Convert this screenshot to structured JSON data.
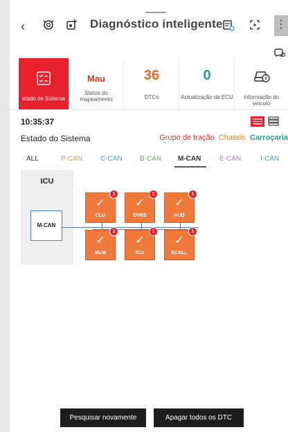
{
  "header": {
    "title": "Diagnóstico inteligente",
    "back_icon": "back-arrow-icon",
    "more_label": "⋮"
  },
  "cards": [
    {
      "main": "",
      "sub": "stado de Sistema",
      "active": true,
      "icon": "checklist-icon"
    },
    {
      "main": "Mau",
      "sub": "Status do mapeamento"
    },
    {
      "main": "36",
      "sub": "DTCs",
      "color": "#e06a2a"
    },
    {
      "main": "0",
      "sub": "Actualização da ECU",
      "color": "#2a9a8e"
    },
    {
      "main": "",
      "sub": "Informação do veículo",
      "icon": "car-info-icon"
    }
  ],
  "status": {
    "time": "10:35:37",
    "title": "Estado do Sistema",
    "links": {
      "tracao": "Grupo de tração",
      "chassis": "Chassis",
      "carrocaria": "Carroçaria"
    }
  },
  "tabs": [
    {
      "label": "ALL",
      "color": "#333333"
    },
    {
      "label": "P-CAN",
      "color": "#e0a24a"
    },
    {
      "label": "C-CAN",
      "color": "#4aa3c9"
    },
    {
      "label": "B-CAN",
      "color": "#6ab04c"
    },
    {
      "label": "M-CAN",
      "color": "#333333",
      "active": true
    },
    {
      "label": "E-CAN",
      "color": "#b07acc"
    },
    {
      "label": "I-CAN",
      "color": "#3aa0b0"
    }
  ],
  "diagram": {
    "ecu_label": "ICU",
    "bus_label": "M-CAN",
    "modules": [
      {
        "name": "CLU",
        "count": "1"
      },
      {
        "name": "DVRS",
        "count": "1"
      },
      {
        "name": "HUD",
        "count": "1"
      },
      {
        "name": "MLM",
        "count": "1"
      },
      {
        "name": "ICU",
        "count": "1"
      },
      {
        "name": "ECALL",
        "count": "1"
      }
    ]
  },
  "buttons": {
    "search_again": "Pesquisar novamente",
    "clear_dtc": "Apagar todos os DTC"
  },
  "colors": {
    "accent": "#e8212e",
    "module": "#f07a3c",
    "bus": "#4a7fb0"
  }
}
